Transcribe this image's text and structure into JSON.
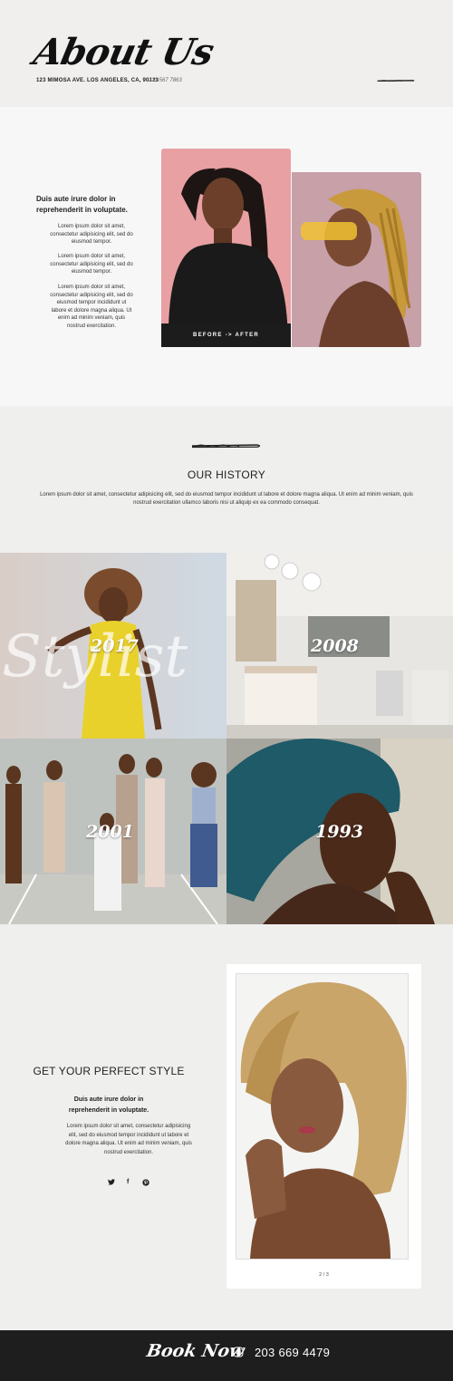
{
  "header": {
    "logo": "About Us",
    "address": "123 MIMOSA AVE. LOS ANGELES, CA, 90123",
    "phone": "213 567 7863"
  },
  "about": {
    "intro": "Duis aute irure dolor in reprehenderit in voluptate.",
    "paragraphs": [
      "Lorem ipsum dolor sit amet, consectetur adipisicing elit, sed do eiusmod tempor.",
      "Lorem ipsum dolor sit amet, consectetur adipisicing elit, sed do eiusmod tempor.",
      "Lorem ipsum dolor sit amet, consectetur adipisicing elit, sed do eiusmod tempor incididunt ut labore et dolore magna aliqua. Ut enim ad minim veniam, quis nostrud exercitation."
    ],
    "before_after_label": "BEFORE -> AFTER"
  },
  "history": {
    "title": "OUR HISTORY",
    "text": "Lorem ipsum dolor sit amet, consectetur adipisicing elit, sed do eiusmod tempor incididunt ut labore et dolore magna aliqua. Ut enim ad minim veniam, quis nostrud exercitation ullamco laboris nisi ut aliquip ex ea commodo consequat.",
    "tiles": [
      {
        "year": "2017",
        "watermark": "Stylist"
      },
      {
        "year": "2008"
      },
      {
        "year": "2001"
      },
      {
        "year": "1993"
      }
    ]
  },
  "style": {
    "title": "GET YOUR PERFECT STYLE",
    "intro": "Duis aute irure dolor in reprehenderit in voluptate.",
    "text": "Lorem ipsum dolor sit amet, consectetur adipisicing elit, sed do eiusmod tempor incididunt ut labore et dolore magna aliqua. Ut enim ad minim veniam, quis nostrud exercitation.",
    "social": [
      {
        "icon": "twitter-icon",
        "glyph": "🐦"
      },
      {
        "icon": "facebook-icon",
        "glyph": "f"
      },
      {
        "icon": "pinterest-icon",
        "glyph": "p"
      }
    ],
    "pager": "2 / 3"
  },
  "footer": {
    "book_label": "Book Now",
    "phone": "203 669 4479",
    "icon": "instagram-icon"
  },
  "colors": {
    "footer_bg": "#1e1e1e",
    "page_bg": "#f2f2f1",
    "before_bg": "#e59b9c",
    "after_bg": "#c99ea6"
  }
}
